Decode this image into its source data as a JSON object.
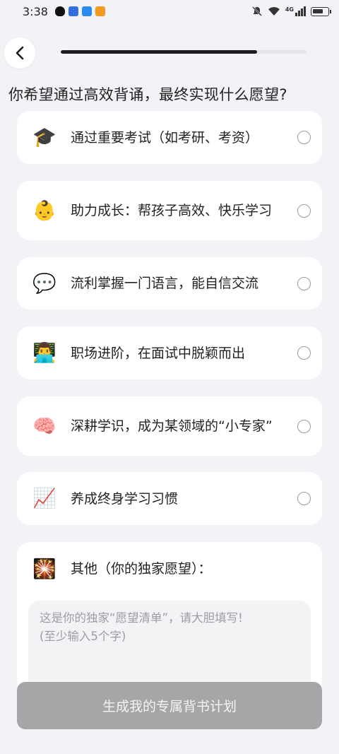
{
  "status_bar": {
    "time": "3:38",
    "left_icons": [
      "penguin-app-icon",
      "shield-app-icon",
      "cloud-app-icon",
      "video-app-icon"
    ],
    "right_icons": [
      "mute-bell-icon",
      "wifi-icon",
      "signal-4g-icon",
      "battery-icon"
    ],
    "network_label": "4G",
    "battery_level": 0.75
  },
  "progress": {
    "value": 0.8
  },
  "question": "你希望通过高效背诵，最终实现什么愿望?",
  "options": [
    {
      "icon": "graduation-cap-icon",
      "emoji": "🎓",
      "label": "通过重要考试（如考研、考资）",
      "selected": false
    },
    {
      "icon": "baby-face-icon",
      "emoji": "👶",
      "label": "助力成长：帮孩子高效、快乐学习",
      "selected": false
    },
    {
      "icon": "speech-bubble-icon",
      "emoji": "💬",
      "label": "流利掌握一门语言，能自信交流",
      "selected": false
    },
    {
      "icon": "office-worker-icon",
      "emoji": "👨‍💻",
      "label": "职场进阶，在面试中脱颖而出",
      "selected": false
    },
    {
      "icon": "brain-icon",
      "emoji": "🧠",
      "label": "深耕学识，成为某领域的“小专家”",
      "selected": false
    },
    {
      "icon": "chart-increasing-icon",
      "emoji": "📈",
      "label": "养成终身学习习惯",
      "selected": false
    }
  ],
  "other": {
    "icon": "sparkler-icon",
    "emoji": "🎇",
    "label": "其他（你的独家愿望）：",
    "placeholder": "这是你的独家“愿望清单”，请大胆填写!\n(至少输入5个字)"
  },
  "submit_label": "生成我的专属背书计划",
  "colors": {
    "background": "#f3f3f7",
    "card": "#ffffff",
    "progress_fill": "#1c1c1f",
    "button_disabled": "#a6a6a8"
  }
}
